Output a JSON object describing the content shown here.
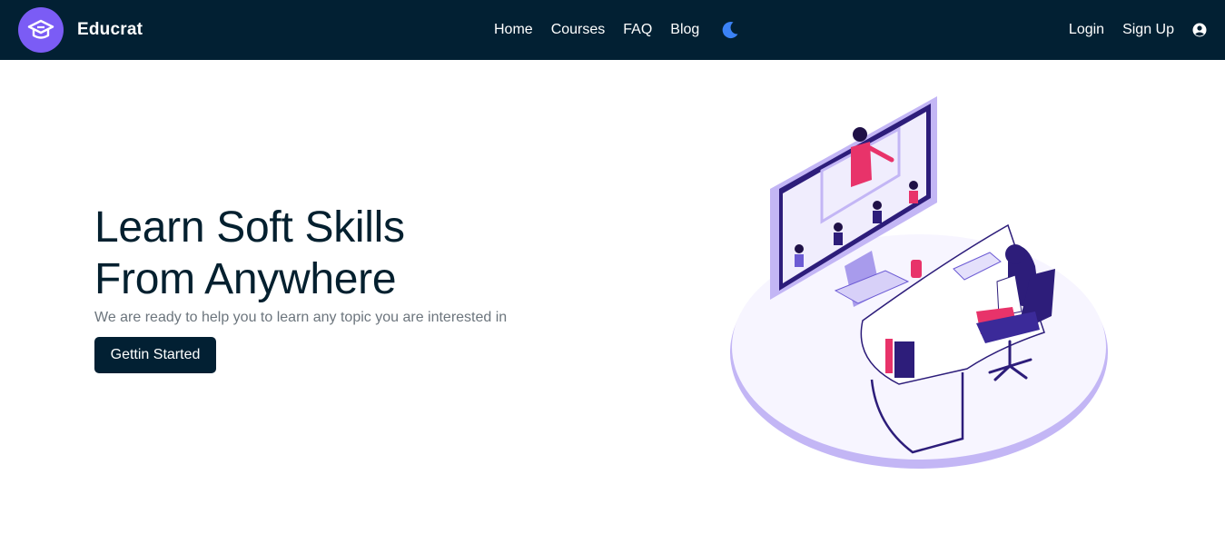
{
  "brand": {
    "name": "Educrat",
    "logo_icon": "graduation-cap-icon"
  },
  "nav": {
    "links": [
      {
        "label": "Home"
      },
      {
        "label": "Courses"
      },
      {
        "label": "FAQ"
      },
      {
        "label": "Blog"
      }
    ],
    "theme_toggle_icon": "moon-icon",
    "auth": {
      "login": "Login",
      "signup": "Sign Up"
    },
    "account_icon": "user-circle-icon"
  },
  "hero": {
    "title_line1": "Learn Soft Skills",
    "title_line2": "From Anywhere",
    "subtitle": "We are ready to help you to learn any topic you are interested in",
    "cta_label": "Gettin Started"
  },
  "colors": {
    "navbar_bg": "#022033",
    "brand_purple": "#7b5cf5",
    "moon_blue": "#3b82f6",
    "title_text": "#04202f",
    "subtitle_text": "#6c757d"
  }
}
